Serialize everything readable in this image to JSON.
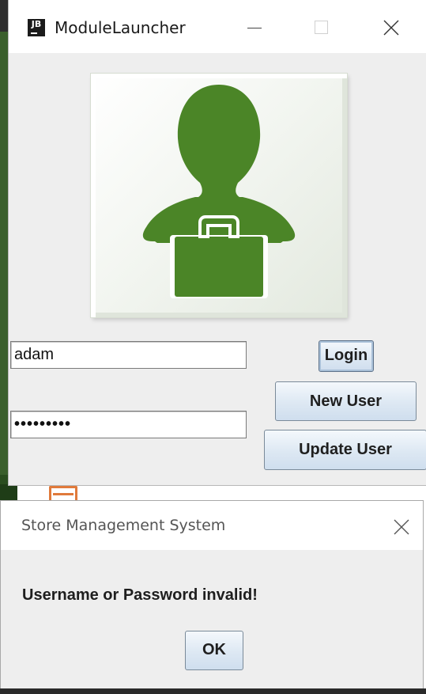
{
  "main_window": {
    "title": "ModuleLauncher",
    "app_icon": "JB",
    "controls": [
      "minimize-icon",
      "maximize-icon",
      "close-icon"
    ],
    "avatar_icon": "business-user-icon",
    "avatar_color": "#4b8527",
    "username_value": "adam",
    "password_value": "•••••••••",
    "login_label": "Login",
    "new_user_label": "New User",
    "update_user_label": "Update User"
  },
  "dialog": {
    "title": "Store Management System",
    "message": "Username or Password invalid!",
    "ok_label": "OK"
  }
}
